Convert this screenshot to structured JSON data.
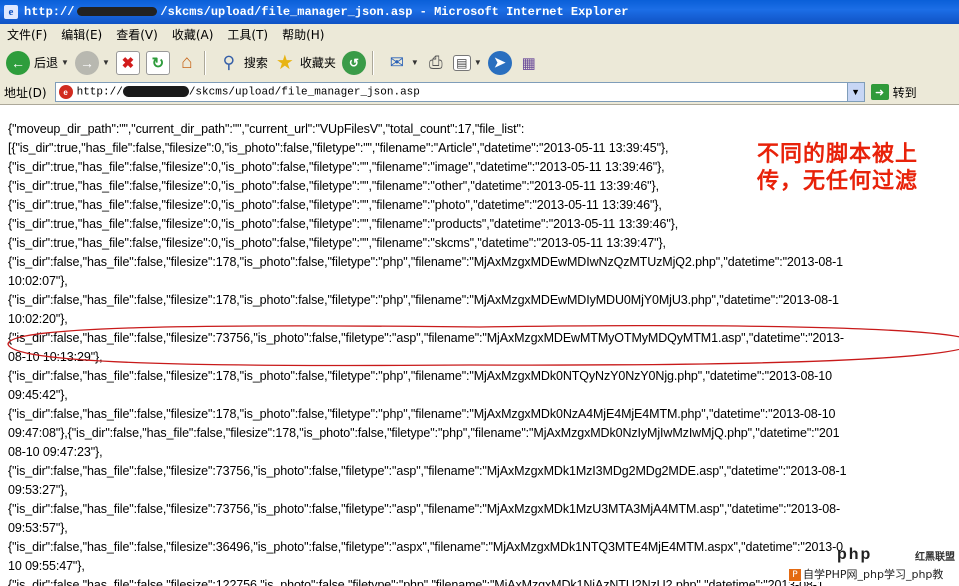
{
  "window": {
    "title_prefix": "http://",
    "title_suffix": "/skcms/upload/file_manager_json.asp - Microsoft Internet Explorer"
  },
  "menu": [
    "文件(F)",
    "编辑(E)",
    "查看(V)",
    "收藏(A)",
    "工具(T)",
    "帮助(H)"
  ],
  "toolbar": {
    "back_label": "后退",
    "search_label": "搜索",
    "favorites_label": "收藏夹"
  },
  "address": {
    "label": "地址(D)",
    "url_prefix": "http://",
    "url_suffix": "/skcms/upload/file_manager_json.asp",
    "go_label": "转到"
  },
  "json_lines": [
    "{\"moveup_dir_path\":\"\",\"current_dir_path\":\"\",\"current_url\":\"VUpFilesV\",\"total_count\":17,\"file_list\":",
    "[{\"is_dir\":true,\"has_file\":false,\"filesize\":0,\"is_photo\":false,\"filetype\":\"\",\"filename\":\"Article\",\"datetime\":\"2013-05-11 13:39:45\"},",
    "{\"is_dir\":true,\"has_file\":false,\"filesize\":0,\"is_photo\":false,\"filetype\":\"\",\"filename\":\"image\",\"datetime\":\"2013-05-11 13:39:46\"},",
    "{\"is_dir\":true,\"has_file\":false,\"filesize\":0,\"is_photo\":false,\"filetype\":\"\",\"filename\":\"other\",\"datetime\":\"2013-05-11 13:39:46\"},",
    "{\"is_dir\":true,\"has_file\":false,\"filesize\":0,\"is_photo\":false,\"filetype\":\"\",\"filename\":\"photo\",\"datetime\":\"2013-05-11 13:39:46\"},",
    "{\"is_dir\":true,\"has_file\":false,\"filesize\":0,\"is_photo\":false,\"filetype\":\"\",\"filename\":\"products\",\"datetime\":\"2013-05-11 13:39:46\"},",
    "{\"is_dir\":true,\"has_file\":false,\"filesize\":0,\"is_photo\":false,\"filetype\":\"\",\"filename\":\"skcms\",\"datetime\":\"2013-05-11 13:39:47\"},",
    "{\"is_dir\":false,\"has_file\":false,\"filesize\":178,\"is_photo\":false,\"filetype\":\"php\",\"filename\":\"MjAxMzgxMDEwMDIwNzQzMTUzMjQ2.php\",\"datetime\":\"2013-08-1",
    "10:02:07\"},",
    "{\"is_dir\":false,\"has_file\":false,\"filesize\":178,\"is_photo\":false,\"filetype\":\"php\",\"filename\":\"MjAxMzgxMDEwMDIyMDU0MjY0MjU3.php\",\"datetime\":\"2013-08-1",
    "10:02:20\"},",
    "{\"is_dir\":false,\"has_file\":false,\"filesize\":73756,\"is_photo\":false,\"filetype\":\"asp\",\"filename\":\"MjAxMzgxMDEwMTMyOTMyMDQyMTM1.asp\",\"datetime\":\"2013-",
    "08-10 10:13:29\"},",
    "{\"is_dir\":false,\"has_file\":false,\"filesize\":178,\"is_photo\":false,\"filetype\":\"php\",\"filename\":\"MjAxMzgxMDk0NTQyNzY0NzY0Njg.php\",\"datetime\":\"2013-08-10",
    "09:45:42\"},",
    "{\"is_dir\":false,\"has_file\":false,\"filesize\":178,\"is_photo\":false,\"filetype\":\"php\",\"filename\":\"MjAxMzgxMDk0NzA4MjE4MjE4MTM.php\",\"datetime\":\"2013-08-10",
    "09:47:08\"},{\"is_dir\":false,\"has_file\":false,\"filesize\":178,\"is_photo\":false,\"filetype\":\"php\",\"filename\":\"MjAxMzgxMDk0NzIyMjIwMzIwMjQ.php\",\"datetime\":\"201",
    "08-10 09:47:23\"},",
    "{\"is_dir\":false,\"has_file\":false,\"filesize\":73756,\"is_photo\":false,\"filetype\":\"asp\",\"filename\":\"MjAxMzgxMDk1MzI3MDg2MDg2MDE.asp\",\"datetime\":\"2013-08-1",
    "09:53:27\"},",
    "{\"is_dir\":false,\"has_file\":false,\"filesize\":73756,\"is_photo\":false,\"filetype\":\"asp\",\"filename\":\"MjAxMzgxMDk1MzU3MTA3MjA4MTM.asp\",\"datetime\":\"2013-08-",
    "09:53:57\"},",
    "{\"is_dir\":false,\"has_file\":false,\"filesize\":36496,\"is_photo\":false,\"filetype\":\"aspx\",\"filename\":\"MjAxMzgxMDk1NTQ3MTE4MjE4MTM.aspx\",\"datetime\":\"2013-0",
    "10 09:55:47\"},",
    "{\"is_dir\":false,\"has_file\":false,\"filesize\":122756,\"is_photo\":false,\"filetype\":\"php\",\"filename\":\"MjAxMzgxMDk1NjAzNTU2NzU2.php\",\"datetime\":\"2013-08-1"
  ],
  "annotation": {
    "line1": "不同的脚本被上",
    "line2": "传，无任何过滤",
    "color": "#e8220a"
  },
  "watermark": {
    "logo": "php",
    "logo_right": "红黑联盟",
    "text": "自学PHP网_php学习_php教"
  }
}
